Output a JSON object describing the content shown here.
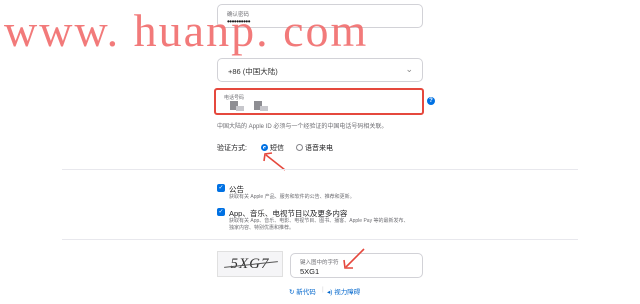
{
  "form": {
    "confirm_password": {
      "label": "确认密码",
      "masked_value": "••••••••••"
    },
    "country": {
      "value": "+86 (中国大陆)",
      "chevron": "⌄"
    },
    "phone": {
      "label": "电话号码"
    },
    "info_icon": "?",
    "phone_note": "中国大陆的 Apple ID 必须与一个经验证的中国电话号码相关联。",
    "verify": {
      "label": "验证方式:",
      "options": [
        {
          "label": "短信",
          "selected": true
        },
        {
          "label": "语音来电",
          "selected": false
        }
      ]
    },
    "subscriptions": [
      {
        "title": "公告",
        "desc": "获取有关 Apple 产品、服务和软件的公告、推荐和更新。",
        "checked": true
      },
      {
        "title": "App、音乐、电视节目以及更多内容",
        "desc_line1": "获取有关 App、音乐、电影、电视节目、图书、播客、Apple Pay 等的最新发布、",
        "desc_line2": "独家内容、特别优惠和推荐。",
        "checked": true
      }
    ],
    "captcha": {
      "image_text": "5XG7",
      "input_label": "键入图中的字符",
      "input_value": "5XG1",
      "new_code": "新代码",
      "separator": "|",
      "audio": "视力障碍"
    }
  },
  "watermark": "www. huanp. com",
  "annotations": {
    "color": "#e5483d"
  },
  "colors": {
    "accent": "#0071e3",
    "link": "#0066cc"
  }
}
